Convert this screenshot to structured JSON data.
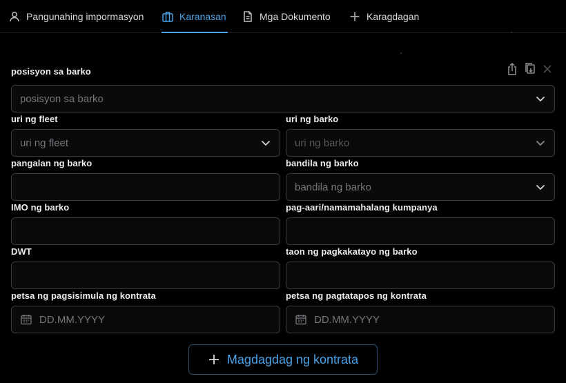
{
  "tabs": [
    {
      "label": "Pangunahing impormasyon",
      "icon": "user-icon",
      "active": false
    },
    {
      "label": "Karanasan",
      "icon": "briefcase-icon",
      "active": true
    },
    {
      "label": "Mga Dokumento",
      "icon": "document-icon",
      "active": false
    },
    {
      "label": "Karagdagan",
      "icon": "plus-icon",
      "active": false
    }
  ],
  "form": {
    "position": {
      "label": "posisyon sa barko",
      "placeholder": "posisyon sa barko"
    },
    "fleet_type": {
      "label": "uri ng fleet",
      "placeholder": "uri ng fleet"
    },
    "ship_type": {
      "label": "uri ng barko",
      "placeholder": "uri ng barko"
    },
    "ship_name": {
      "label": "pangalan ng barko",
      "value": ""
    },
    "ship_flag": {
      "label": "bandila ng barko",
      "placeholder": "bandila ng barko"
    },
    "imo": {
      "label": "IMO ng barko",
      "value": ""
    },
    "owner": {
      "label": "pag-aari/namamahalang kumpanya",
      "value": ""
    },
    "dwt": {
      "label": "DWT",
      "value": ""
    },
    "build_year": {
      "label": "taon ng pagkakatayo ng barko",
      "value": ""
    },
    "contract_start": {
      "label": "petsa ng pagsisimula ng kontrata",
      "placeholder": "DD.MM.YYYY"
    },
    "contract_end": {
      "label": "petsa ng pagtatapos ng kontrata",
      "placeholder": "DD.MM.YYYY"
    }
  },
  "add_contract_label": "Magdagdag ng kontrata",
  "colors": {
    "accent": "#4aa3e8",
    "background": "#000000",
    "border": "#3a3a40"
  }
}
